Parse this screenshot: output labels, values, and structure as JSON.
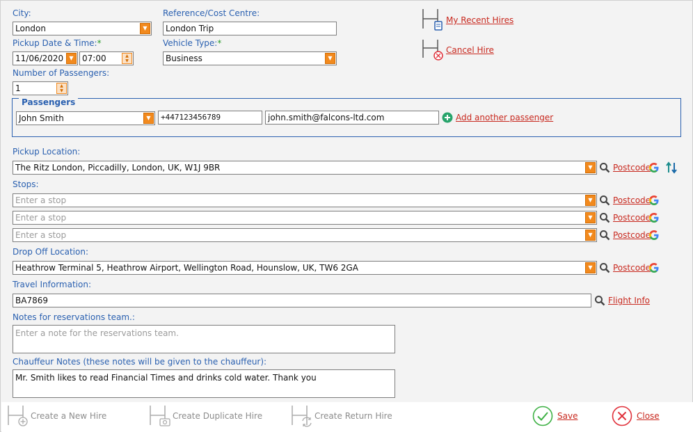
{
  "form": {
    "city": {
      "label": "City:",
      "value": "London"
    },
    "reference": {
      "label": "Reference/Cost Centre:",
      "value": "London Trip"
    },
    "pickup_datetime": {
      "label": "Pickup Date & Time:",
      "required": "*",
      "date": "11/06/2020",
      "time": "07:00"
    },
    "vehicle_type": {
      "label": "Vehicle Type:",
      "required": "*",
      "value": "Business"
    },
    "num_passengers": {
      "label": "Number of Passengers:",
      "value": "1"
    }
  },
  "side_links": {
    "recent_hires": "My Recent Hires",
    "cancel_hire": "Cancel Hire"
  },
  "passengers": {
    "legend": "Passengers",
    "name": "John Smith",
    "phone": "+447123456789",
    "email": "john.smith@falcons-ltd.com",
    "add_label": "Add another passenger"
  },
  "pickup": {
    "label": "Pickup Location:",
    "value": "The Ritz London, Piccadilly, London, UK, W1J 9BR",
    "postcode": "Postcode"
  },
  "stops": {
    "label": "Stops:",
    "items": [
      {
        "placeholder": "Enter a stop",
        "postcode": "Postcode"
      },
      {
        "placeholder": "Enter a stop",
        "postcode": "Postcode"
      },
      {
        "placeholder": "Enter a stop",
        "postcode": "Postcode"
      }
    ]
  },
  "dropoff": {
    "label": "Drop Off Location:",
    "value": "Heathrow Terminal 5, Heathrow Airport, Wellington Road, Hounslow, UK, TW6 2GA",
    "postcode": "Postcode"
  },
  "travel": {
    "label": "Travel Information:",
    "value": "BA7869",
    "flight_info": "Flight Info"
  },
  "notes": {
    "label": "Notes for reservations team.:",
    "placeholder": "Enter a note for the reservations team."
  },
  "chauffeur": {
    "label": "Chauffeur Notes (these notes will be given to the chauffeur):",
    "value": "Mr. Smith likes to read Financial Times and drinks cold water. Thank you"
  },
  "footer": {
    "new_hire": "Create a New Hire",
    "duplicate_hire": "Create Duplicate Hire",
    "return_hire": "Create Return Hire",
    "save": "Save",
    "close": "Close"
  },
  "colors": {
    "label_blue": "#2a60b0",
    "link_red": "#c8281e",
    "dropdown_orange": "#f28a1e",
    "save_green": "#3cb043",
    "close_red": "#e0303a"
  }
}
